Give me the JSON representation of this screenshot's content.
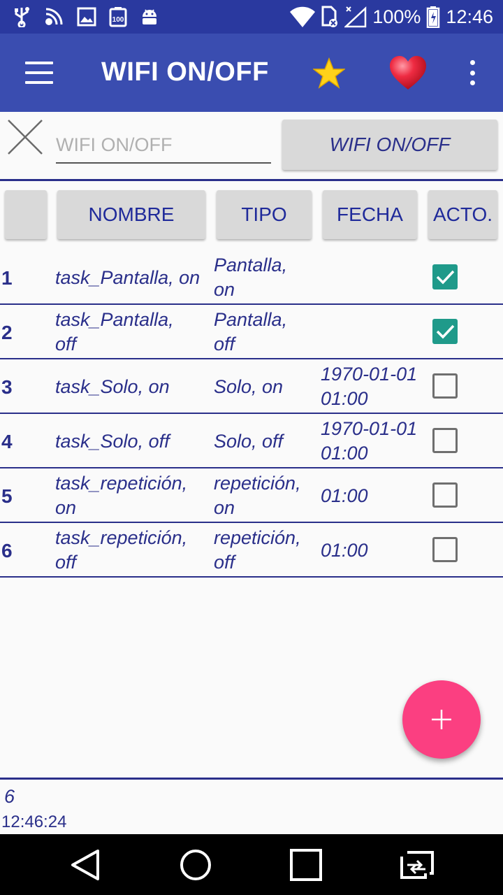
{
  "status_bar": {
    "battery": "100%",
    "time": "12:46",
    "icons": [
      "usb-icon",
      "cast-icon",
      "image-icon",
      "battery-100-icon",
      "android-icon",
      "wifi-icon",
      "sim-icon",
      "signal-icon",
      "battery-icon"
    ]
  },
  "app_bar": {
    "title": "WIFI ON/OFF",
    "icons": [
      "menu-icon",
      "star-icon",
      "heart-icon",
      "more-icon"
    ],
    "colors": {
      "primary": "#3a4db0",
      "dark": "#2a399f",
      "star": "#ffd21a",
      "heart": "#e8243a"
    }
  },
  "search": {
    "placeholder": "WIFI ON/OFF",
    "value": "",
    "button_label": "WIFI ON/OFF"
  },
  "headers": [
    "",
    "NOMBRE",
    "TIPO",
    "FECHA",
    "ACTO."
  ],
  "rows": [
    {
      "num": "1",
      "name_l1": "task_Pantalla, on",
      "name_l2": "",
      "type_l1": "Pantalla,",
      "type_l2": "on",
      "date_l1": "",
      "date_l2": "",
      "active": true
    },
    {
      "num": "2",
      "name_l1": "task_Pantalla,",
      "name_l2": "off",
      "type_l1": "Pantalla,",
      "type_l2": "off",
      "date_l1": "",
      "date_l2": "",
      "active": true
    },
    {
      "num": "3",
      "name_l1": "task_Solo, on",
      "name_l2": "",
      "type_l1": "Solo, on",
      "type_l2": "",
      "date_l1": "1970-01-01",
      "date_l2": "01:00",
      "active": false
    },
    {
      "num": "4",
      "name_l1": "task_Solo, off",
      "name_l2": "",
      "type_l1": "Solo, off",
      "type_l2": "",
      "date_l1": "1970-01-01",
      "date_l2": "01:00",
      "active": false
    },
    {
      "num": "5",
      "name_l1": "task_repetición,",
      "name_l2": "on",
      "type_l1": "repetición,",
      "type_l2": "on",
      "date_l1": "01:00",
      "date_l2": "",
      "active": false
    },
    {
      "num": "6",
      "name_l1": "task_repetición,",
      "name_l2": "off",
      "type_l1": "repetición,",
      "type_l2": "off",
      "date_l1": "01:00",
      "date_l2": "",
      "active": false
    }
  ],
  "fab": {
    "icon": "plus-icon",
    "color": "#fb3f81"
  },
  "footer": {
    "count": "6",
    "time": "12:46:24"
  },
  "nav_bar": {
    "icons": [
      "back-icon",
      "home-icon",
      "recents-icon",
      "switch-icon"
    ]
  }
}
